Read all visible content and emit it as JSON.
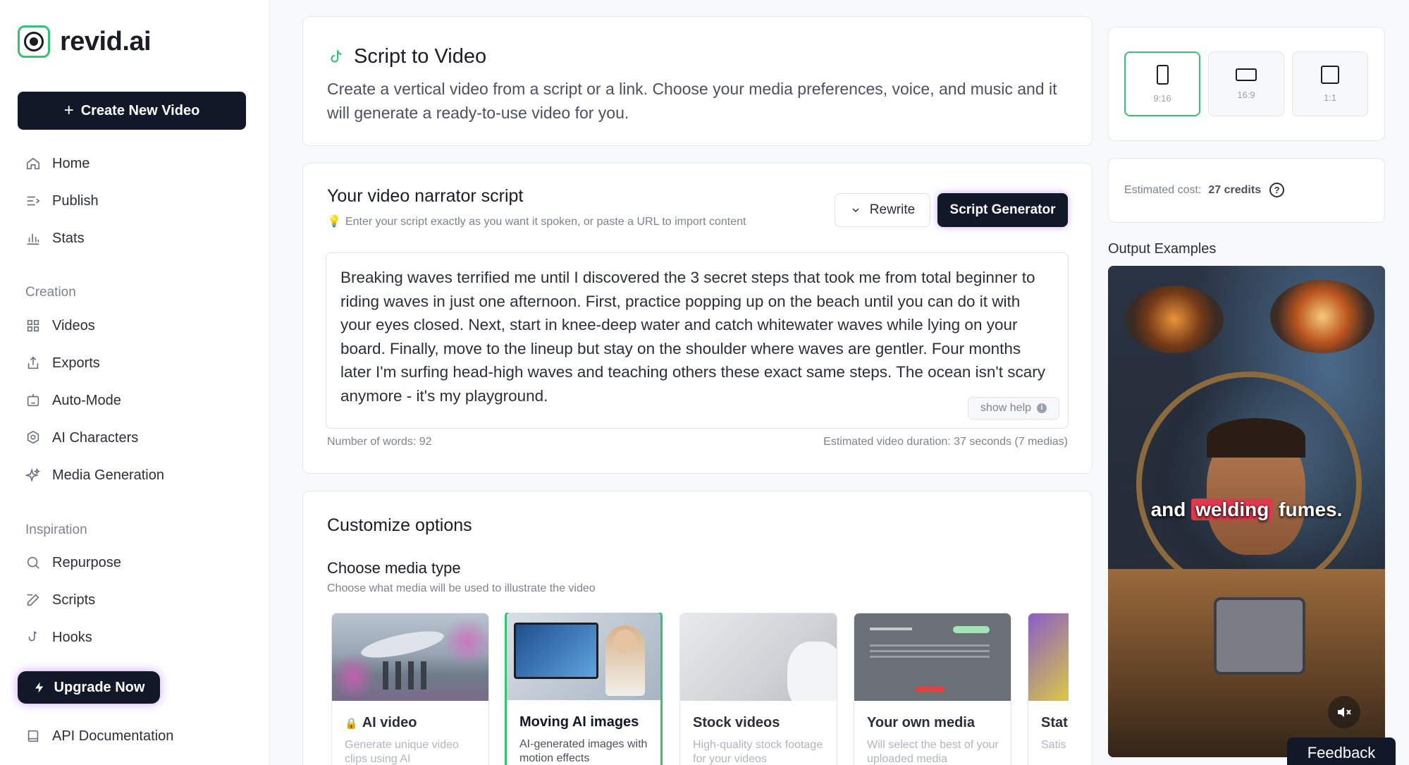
{
  "brand": {
    "name": "revid.ai"
  },
  "sidebar": {
    "create_button": "Create New Video",
    "main_items": [
      {
        "label": "Home",
        "icon": "home-icon"
      },
      {
        "label": "Publish",
        "icon": "publish-icon"
      },
      {
        "label": "Stats",
        "icon": "stats-icon"
      }
    ],
    "creation_label": "Creation",
    "creation_items": [
      {
        "label": "Videos",
        "icon": "grid-icon"
      },
      {
        "label": "Exports",
        "icon": "export-icon"
      },
      {
        "label": "Auto-Mode",
        "icon": "auto-mode-icon"
      },
      {
        "label": "AI Characters",
        "icon": "ai-characters-icon"
      },
      {
        "label": "Media Generation",
        "icon": "sparkles-icon"
      }
    ],
    "inspiration_label": "Inspiration",
    "inspiration_items": [
      {
        "label": "Repurpose",
        "icon": "search-icon"
      },
      {
        "label": "Scripts",
        "icon": "edit-icon"
      },
      {
        "label": "Hooks",
        "icon": "hook-icon"
      }
    ],
    "upgrade_button": "Upgrade Now",
    "api_docs": "API Documentation"
  },
  "intro": {
    "title": "Script to Video",
    "description": "Create a vertical video from a script or a link. Choose your media preferences, voice, and music and it will generate a ready-to-use video for you."
  },
  "script": {
    "heading": "Your video narrator script",
    "hint": "Enter your script exactly as you want it spoken, or paste a URL to import content",
    "rewrite_button": "Rewrite",
    "generator_button": "Script Generator",
    "text": "Breaking waves terrified me until I discovered the 3 secret steps that took me from total beginner to riding waves in just one afternoon. First, practice popping up on the beach until you can do it with your eyes closed. Next, start in knee-deep water and catch whitewater waves while lying on your board. Finally, move to the lineup but stay on the shoulder where waves are gentler. Four months later I'm surfing head-high waves and teaching others these exact same steps. The ocean isn't scary anymore - it's my playground.",
    "show_help": "show help",
    "word_count": "Number of words: 92",
    "duration": "Estimated video duration: 37 seconds (7 medias)"
  },
  "customize": {
    "heading": "Customize options",
    "media_type_heading": "Choose media type",
    "media_type_desc": "Choose what media will be used to illustrate the video",
    "media_types": [
      {
        "name": "AI video",
        "desc": "Generate unique video clips using AI",
        "locked": true,
        "selected": false
      },
      {
        "name": "Moving AI images",
        "desc": "AI-generated images with motion effects",
        "locked": false,
        "selected": true
      },
      {
        "name": "Stock videos",
        "desc": "High-quality stock footage for your videos",
        "locked": false,
        "selected": false
      },
      {
        "name": "Your own media",
        "desc": "Will select the best of your uploaded media",
        "locked": false,
        "selected": false
      },
      {
        "name": "Stati",
        "desc": "Satis grab",
        "locked": false,
        "selected": false
      }
    ]
  },
  "aspect_ratios": [
    {
      "label": "9:16",
      "active": true
    },
    {
      "label": "16:9",
      "active": false
    },
    {
      "label": "1:1",
      "active": false
    }
  ],
  "cost": {
    "label": "Estimated cost:",
    "value": "27 credits"
  },
  "output": {
    "label": "Output Examples",
    "caption_pre": "and",
    "caption_highlight": "welding",
    "caption_post": "fumes."
  },
  "feedback": "Feedback",
  "colors": {
    "accent": "#38c172",
    "dark": "#111827",
    "glow": "#a855f7"
  }
}
